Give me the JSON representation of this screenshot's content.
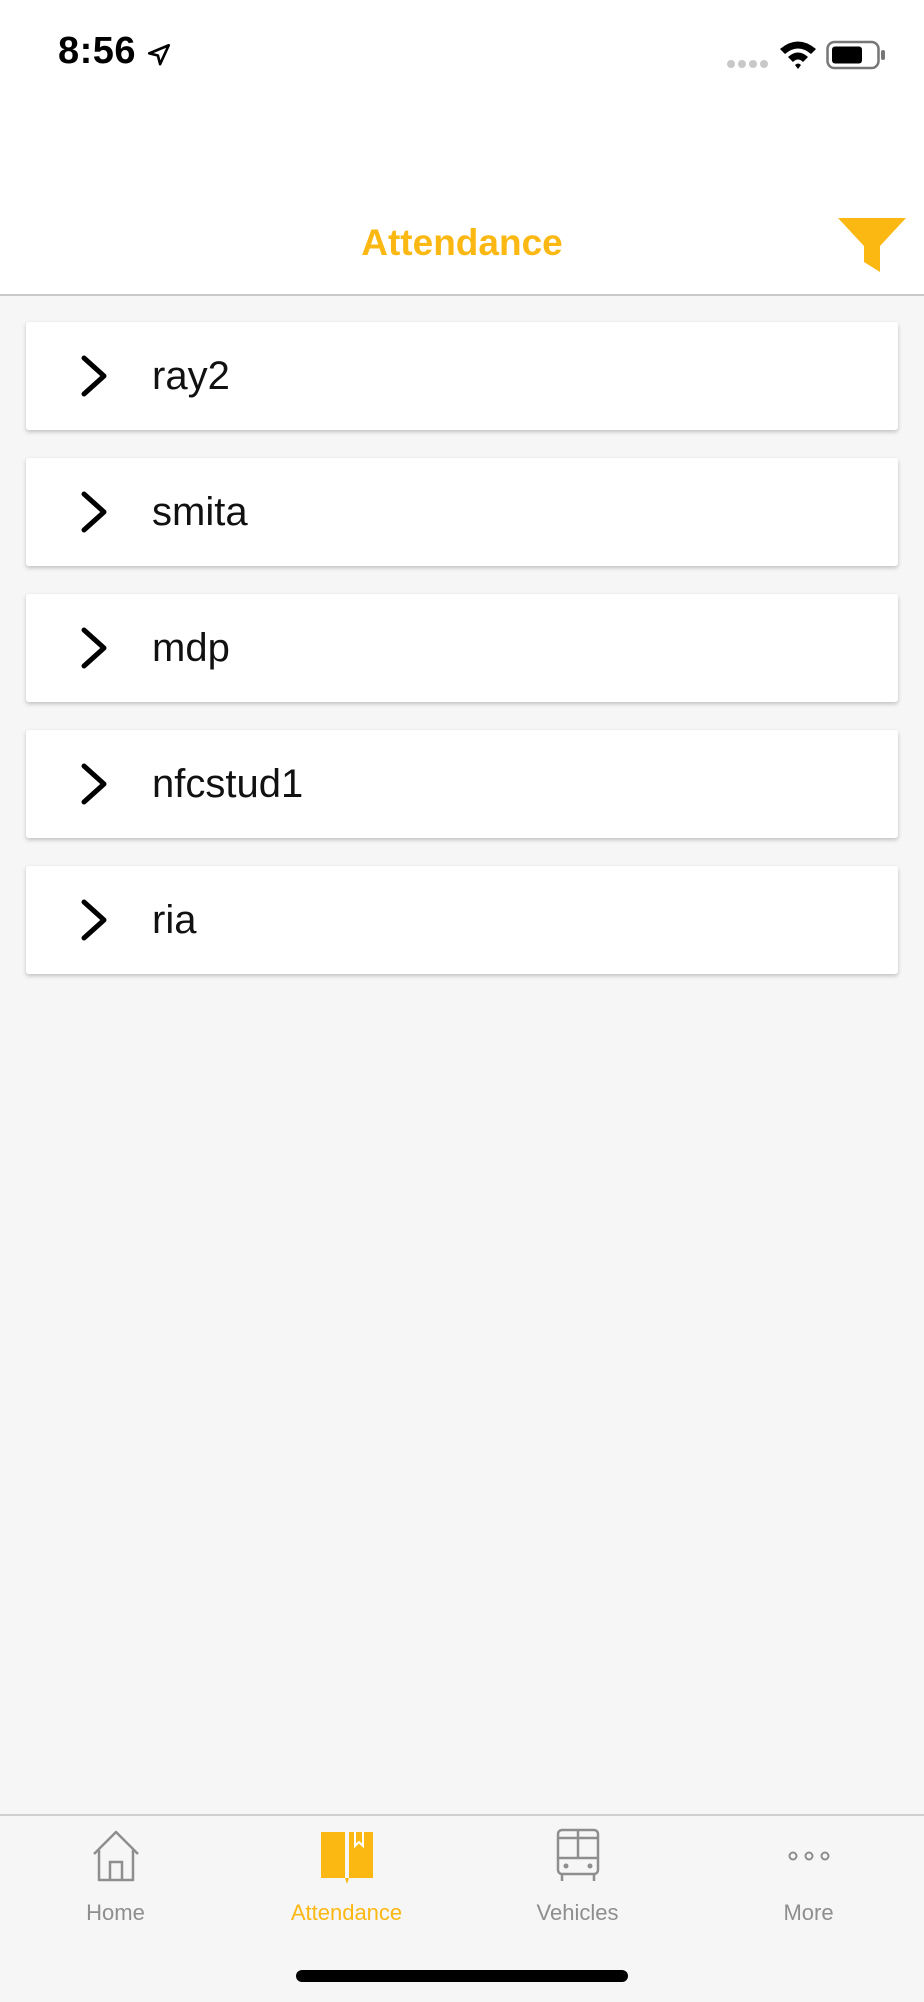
{
  "status_bar": {
    "time": "8:56",
    "icons": [
      "location-arrow-icon",
      "cellular-signal-icon",
      "wifi-icon",
      "battery-icon"
    ]
  },
  "header": {
    "title": "Attendance",
    "filter_icon": "funnel-icon"
  },
  "students": [
    {
      "label": "ray2",
      "icon": "chevron-right-icon"
    },
    {
      "label": "smita",
      "icon": "chevron-right-icon"
    },
    {
      "label": "mdp",
      "icon": "chevron-right-icon"
    },
    {
      "label": "nfcstud1",
      "icon": "chevron-right-icon"
    },
    {
      "label": "ria",
      "icon": "chevron-right-icon"
    }
  ],
  "tab_bar": {
    "tabs": [
      {
        "label": "Home",
        "icon": "home-icon",
        "active": false
      },
      {
        "label": "Attendance",
        "icon": "book-icon",
        "active": true
      },
      {
        "label": "Vehicles",
        "icon": "bus-icon",
        "active": false
      },
      {
        "label": "More",
        "icon": "more-dots-icon",
        "active": false
      }
    ]
  },
  "colors": {
    "accent": "#fbb812",
    "background": "#f6f6f6",
    "inactive_tab": "#8e8e8e"
  }
}
